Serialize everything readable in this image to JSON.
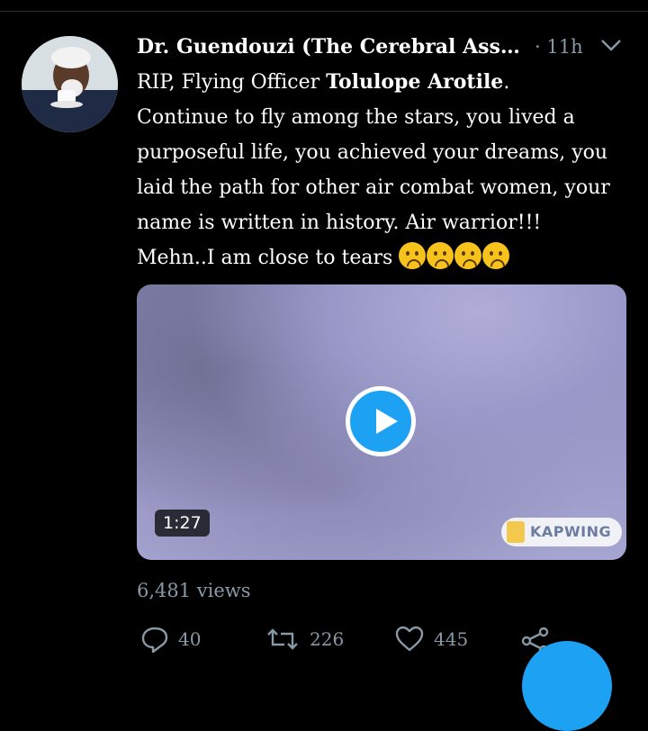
{
  "tweet": {
    "author_name": "Dr. Guendouzi (The Cerebral Assassi...",
    "meta": "· 11h",
    "lines": [
      {
        "prefix": "RIP, Flying Officer ",
        "bold": "Tolulope Arotile",
        "suffix": "."
      },
      {
        "text": "Continue to fly among the stars, you lived a purposeful life, you achieved your dreams, you laid the path for other air combat women, your name is written in history. Air warrior!!!"
      },
      {
        "text": "Mehn..I am close to tears",
        "emoji_icons": [
          "crying-face-icon",
          "crying-face-icon",
          "crying-face-icon",
          "crying-face-icon"
        ]
      }
    ]
  },
  "media": {
    "duration": "1:27",
    "watermark": "KAPWING"
  },
  "stats": {
    "views": "6,481 views"
  },
  "actions": {
    "reply_count": "40",
    "retweet_count": "226",
    "like_count": "445"
  },
  "colors": {
    "background": "#000000",
    "muted_text": "#8899a6",
    "accent": "#1da1f2"
  }
}
